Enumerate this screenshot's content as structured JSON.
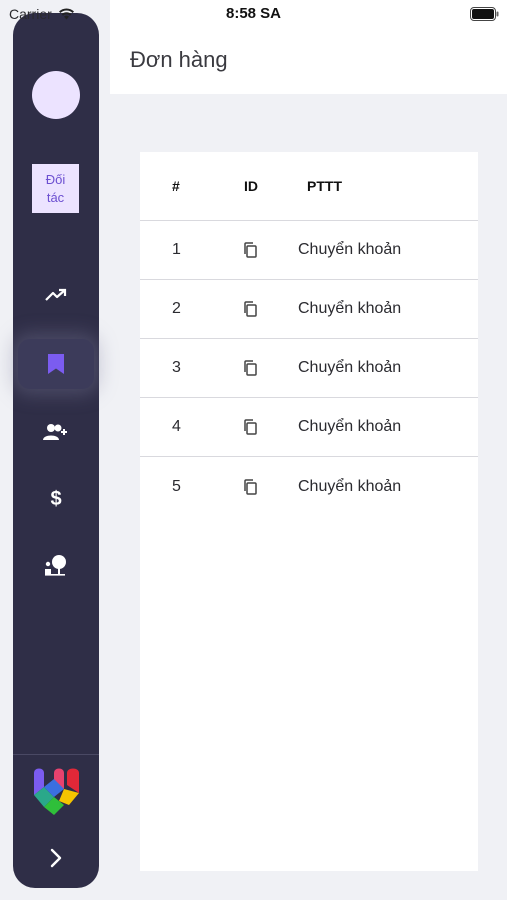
{
  "status_bar": {
    "carrier": "Carrier",
    "time": "8:58 SA"
  },
  "header": {
    "title": "Đơn hàng"
  },
  "sidebar": {
    "partner_label": "Đối tác",
    "nav_items": [
      {
        "icon": "trending-up-icon",
        "active": false
      },
      {
        "icon": "bookmark-icon",
        "active": true
      },
      {
        "icon": "add-users-icon",
        "active": false
      },
      {
        "icon": "dollar-icon",
        "active": false
      },
      {
        "icon": "person-tree-icon",
        "active": false
      }
    ],
    "accent": "#7b5cf0"
  },
  "table": {
    "headers": [
      "#",
      "ID",
      "PTTT"
    ],
    "rows": [
      {
        "num": "1",
        "id_icon": "copy-icon",
        "payment": "Chuyển khoản"
      },
      {
        "num": "2",
        "id_icon": "copy-icon",
        "payment": "Chuyển khoản"
      },
      {
        "num": "3",
        "id_icon": "copy-icon",
        "payment": "Chuyển khoản"
      },
      {
        "num": "4",
        "id_icon": "copy-icon",
        "payment": "Chuyển khoản"
      },
      {
        "num": "5",
        "id_icon": "copy-icon",
        "payment": "Chuyển khoản"
      }
    ]
  }
}
